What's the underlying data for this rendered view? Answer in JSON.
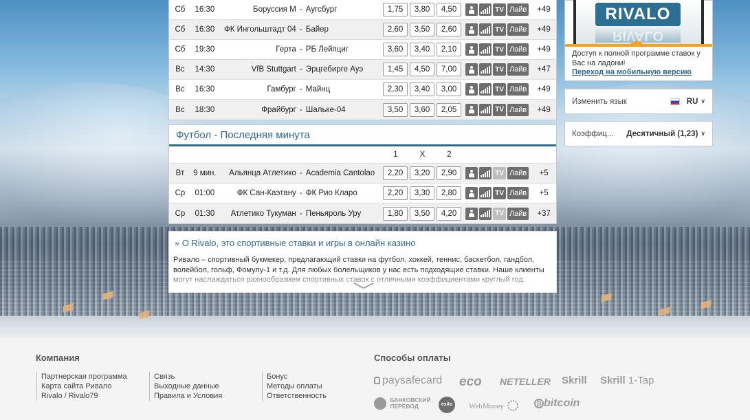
{
  "matches": [
    {
      "day": "Сб",
      "time": "16:30",
      "home": "Боруссия М",
      "away": "Аугсбург",
      "odds": [
        "1,75",
        "3,80",
        "4,50"
      ],
      "more": "+49"
    },
    {
      "day": "Сб",
      "time": "16:30",
      "home": "ФК Ингольштадт 04",
      "away": "Байер",
      "odds": [
        "2,60",
        "3,50",
        "2,60"
      ],
      "more": "+49"
    },
    {
      "day": "Сб",
      "time": "19:30",
      "home": "Герта",
      "away": "РБ Лейпциг",
      "odds": [
        "3,60",
        "3,40",
        "2,10"
      ],
      "more": "+49"
    },
    {
      "day": "Вс",
      "time": "14:30",
      "home": "VfB Stuttgart",
      "away": "Эрцгебирге Ауэ",
      "odds": [
        "1,45",
        "4,50",
        "7,00"
      ],
      "more": "+47"
    },
    {
      "day": "Вс",
      "time": "16:30",
      "home": "Гамбург",
      "away": "Майнц",
      "odds": [
        "2,30",
        "3,40",
        "3,00"
      ],
      "more": "+49"
    },
    {
      "day": "Вс",
      "time": "18:30",
      "home": "Фрайбург",
      "away": "Шальке-04",
      "odds": [
        "3,50",
        "3,60",
        "2,05"
      ],
      "more": "+49"
    }
  ],
  "row_buttons": {
    "tv": "TV",
    "live": "Лайв",
    "dash": "-"
  },
  "last_minute": {
    "title": "Футбол - Последняя минута",
    "headers": [
      "1",
      "X",
      "2"
    ],
    "rows": [
      {
        "day": "Вт",
        "time": "9 мин.",
        "home": "Альянца Атлетико",
        "away": "Academia Cantolao",
        "odds": [
          "2,20",
          "3,20",
          "2,90"
        ],
        "more": "+5",
        "tv_available": false
      },
      {
        "day": "Ср",
        "time": "01:00",
        "home": "ФК Сан-Каэтану",
        "away": "ФК Рио Кларо",
        "odds": [
          "2,20",
          "3,30",
          "2,80"
        ],
        "more": "+5",
        "tv_available": true
      },
      {
        "day": "Ср",
        "time": "01:30",
        "home": "Атлетико Тукуман",
        "away": "Пеньяроль Уру",
        "odds": [
          "1,80",
          "3,50",
          "4,20"
        ],
        "more": "+37",
        "tv_available": false
      }
    ]
  },
  "about": {
    "title": "О Rivalo, это спортивные ставки и игры в онлайн казино",
    "text": "Ривало – спортивный букмекер, предлагающий ставки на футбол, хоккей, теннис, баскетбол, гандбол, волейбол, гольф, Фомулу-1 и т.д. Для любых болельщиков у нас есть подходящие ставки. Наше клиенты могут наслаждаться разнообразием спортивных ставок с отличными коэффициентами круглый год."
  },
  "sidebar": {
    "promo_logo": "RIVALO",
    "promo_text": "Доступ к полной программе ставок у Вас на ладони!",
    "promo_link": "Переход на мобильную версию",
    "language_label": "Изменить язык",
    "language_value": "RU",
    "odds_label": "Коэффиц...",
    "odds_value": "Десятичный (1,23)"
  },
  "footer": {
    "company_heading": "Компания",
    "payment_heading": "Способы оплаты",
    "col1": [
      "Партнерская программа",
      "Карта сайта Ривало",
      "Rivalo / Rivalo79"
    ],
    "col2": [
      "Связь",
      "Выходные данные",
      "Правила и Условия"
    ],
    "col3": [
      "Бонус",
      "Методы оплаты",
      "Ответственность"
    ],
    "payments": {
      "paysafecard": "paysafecard",
      "eco": "eco",
      "neteller": "NETELLER",
      "skrill": "Skrill",
      "skrill1tap_a": "Skrill",
      "skrill1tap_b": "1-Tap",
      "bank_a": "БАНКОВСКИЙ",
      "bank_b": "ПЕРЕВОД",
      "exito": "exito",
      "webmoney": "WebMoney",
      "bitcoin": "bitcoin"
    }
  },
  "colors": {
    "accent": "#2e6791",
    "button": "#6d6d6d",
    "promo_orange": "#f4a21f"
  }
}
